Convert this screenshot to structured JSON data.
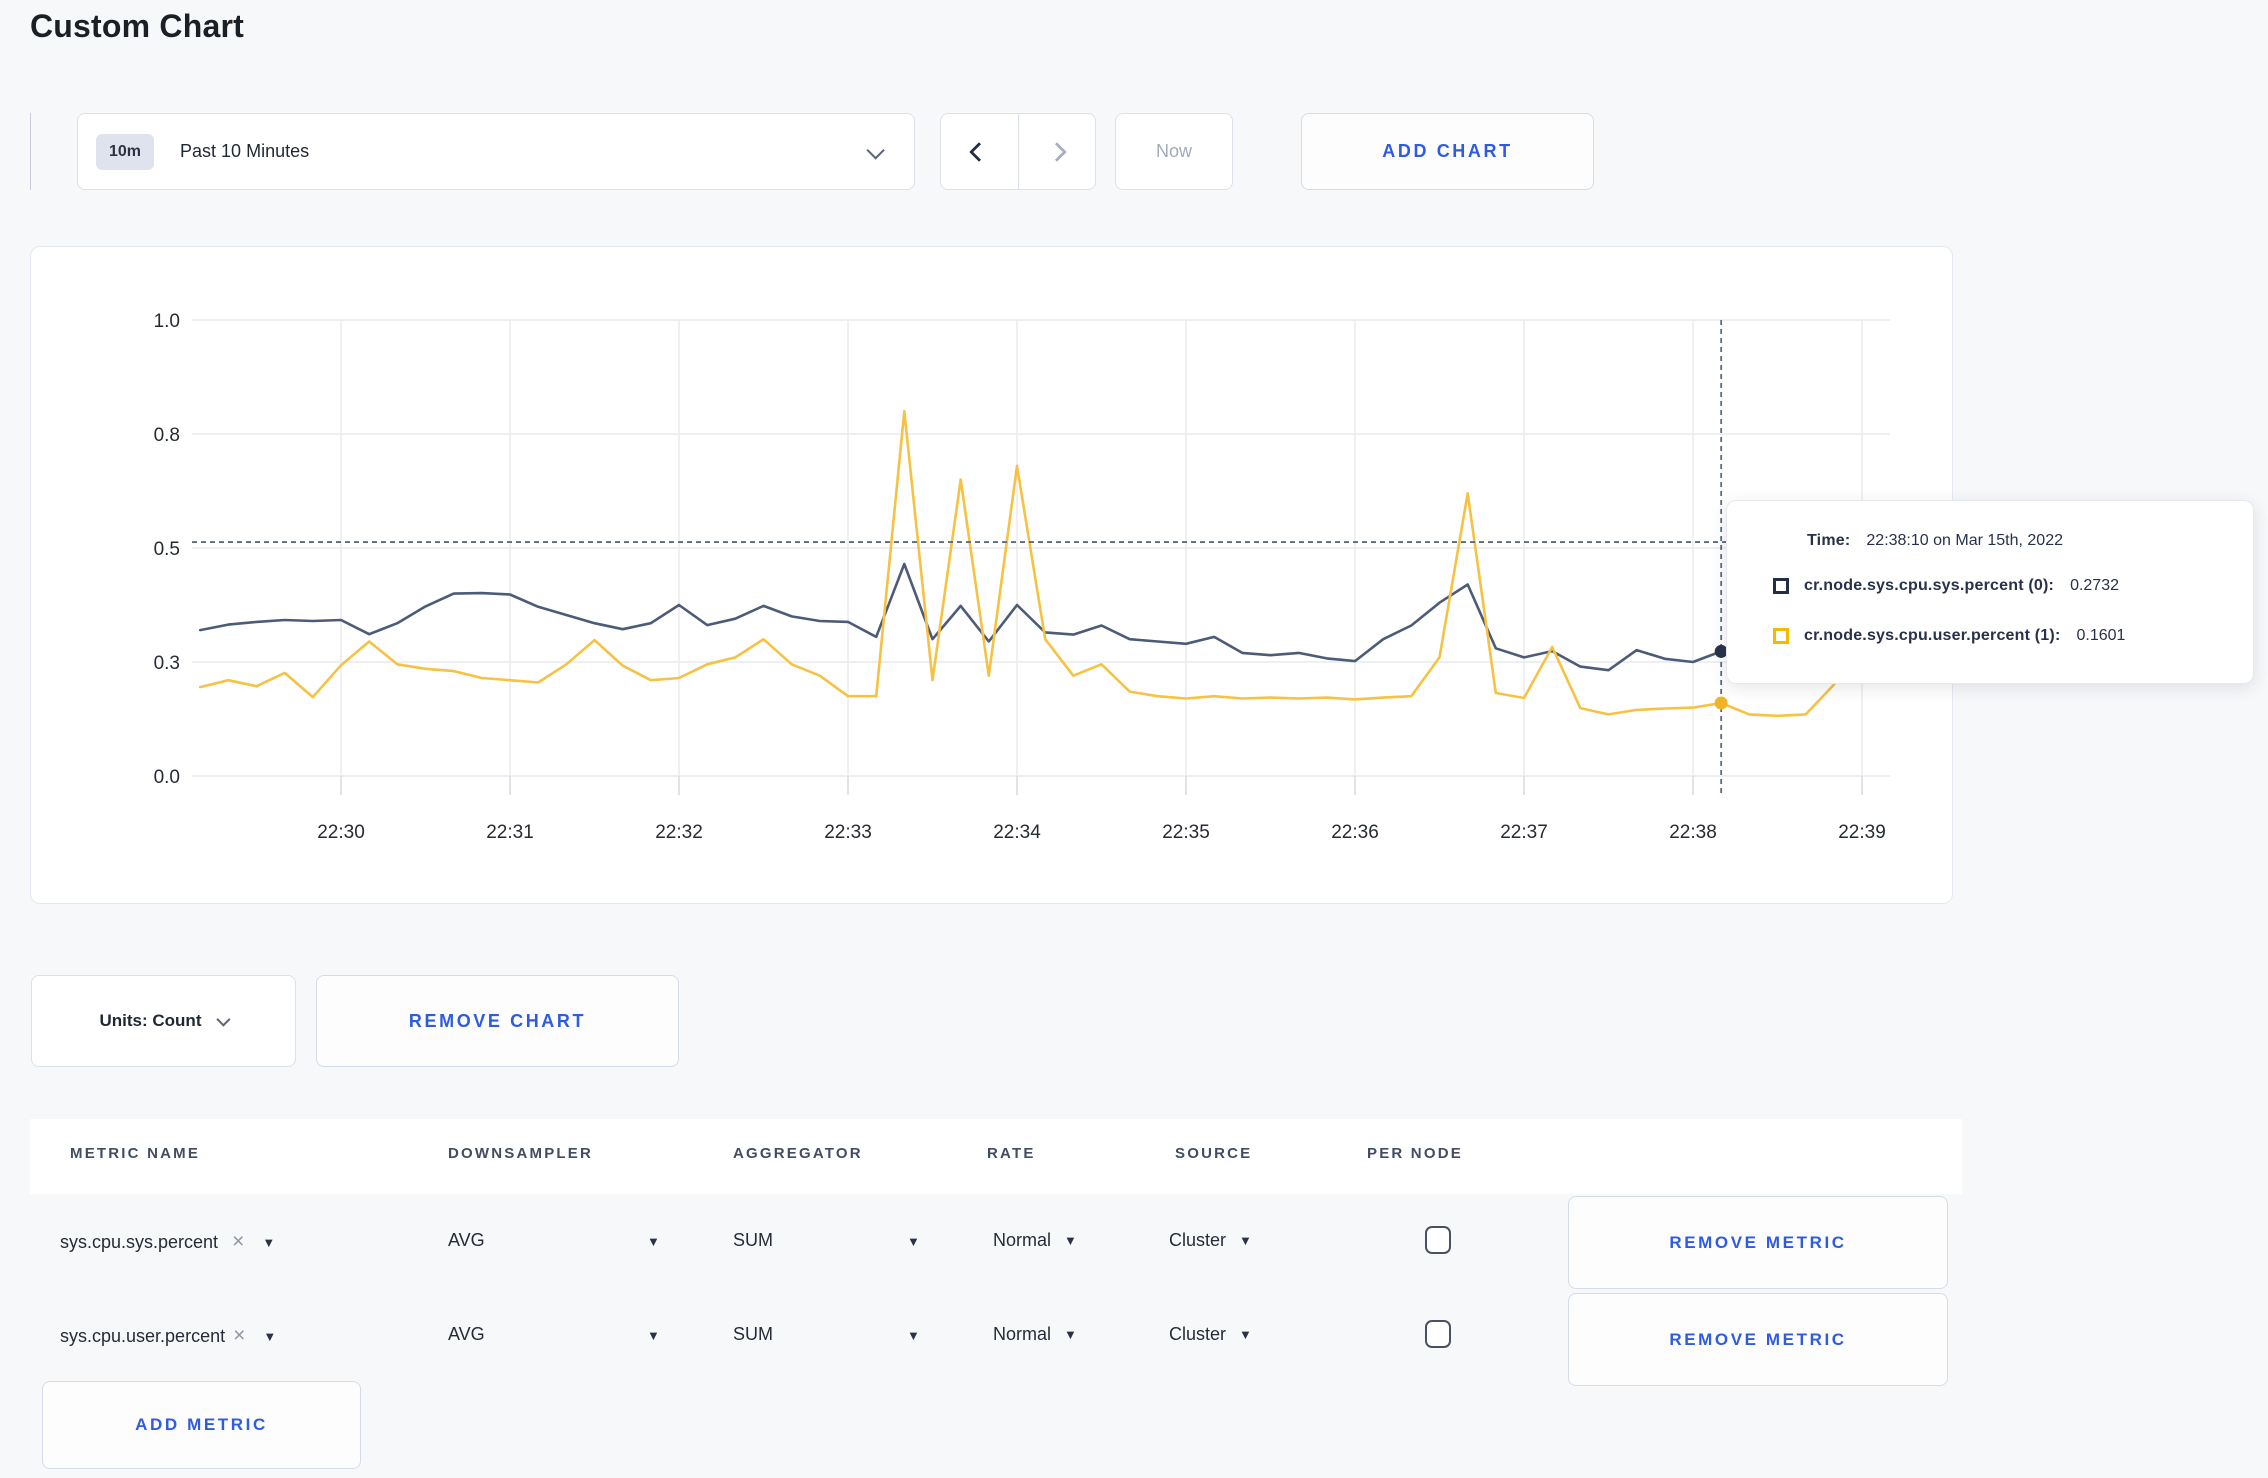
{
  "page": {
    "title": "Custom Chart"
  },
  "toolbar": {
    "range_badge": "10m",
    "range_label": "Past 10 Minutes",
    "now_label": "Now",
    "add_chart_label": "ADD CHART"
  },
  "chart_data": {
    "type": "line",
    "title": "",
    "x_start": "22:29:10",
    "x_step_seconds": 10,
    "x_tick_labels": [
      "22:30",
      "22:31",
      "22:32",
      "22:33",
      "22:34",
      "22:35",
      "22:36",
      "22:37",
      "22:38",
      "22:39"
    ],
    "y_ticks": [
      {
        "label": "0.0",
        "value": 0
      },
      {
        "label": "0.3",
        "value": 0.25
      },
      {
        "label": "0.5",
        "value": 0.5
      },
      {
        "label": "0.8",
        "value": 0.75
      },
      {
        "label": "1.0",
        "value": 1
      }
    ],
    "ylim": [
      0,
      1
    ],
    "grid": true,
    "series": [
      {
        "name": "cr.node.sys.cpu.sys.percent (0)",
        "color": "#4c5b77",
        "marker_color": "#273349",
        "values": [
          0.32,
          0.332,
          0.338,
          0.342,
          0.34,
          0.342,
          0.311,
          0.335,
          0.372,
          0.4,
          0.401,
          0.398,
          0.371,
          0.353,
          0.335,
          0.322,
          0.335,
          0.375,
          0.331,
          0.345,
          0.373,
          0.35,
          0.34,
          0.338,
          0.305,
          0.465,
          0.3,
          0.373,
          0.295,
          0.375,
          0.315,
          0.31,
          0.33,
          0.3,
          0.295,
          0.29,
          0.305,
          0.27,
          0.265,
          0.27,
          0.258,
          0.252,
          0.3,
          0.33,
          0.38,
          0.42,
          0.28,
          0.26,
          0.274,
          0.24,
          0.232,
          0.276,
          0.257,
          0.25,
          0.2732,
          0.262,
          0.27,
          0.29,
          0.3,
          0.295,
          0.3
        ]
      },
      {
        "name": "cr.node.sys.cpu.user.percent (1)",
        "color": "#f6c243",
        "marker_color": "#f0b429",
        "values": [
          0.195,
          0.21,
          0.197,
          0.226,
          0.173,
          0.243,
          0.295,
          0.245,
          0.235,
          0.23,
          0.215,
          0.21,
          0.205,
          0.245,
          0.298,
          0.242,
          0.21,
          0.215,
          0.245,
          0.26,
          0.3,
          0.245,
          0.22,
          0.175,
          0.175,
          0.8,
          0.21,
          0.65,
          0.22,
          0.68,
          0.3,
          0.22,
          0.245,
          0.185,
          0.175,
          0.17,
          0.175,
          0.17,
          0.172,
          0.17,
          0.172,
          0.168,
          0.172,
          0.175,
          0.26,
          0.62,
          0.182,
          0.171,
          0.283,
          0.149,
          0.135,
          0.145,
          0.148,
          0.15,
          0.1601,
          0.135,
          0.132,
          0.135,
          0.2,
          0.272,
          0.245
        ]
      }
    ],
    "crosshair": {
      "time": "22:38:10",
      "minutes_from_2230": 8.1667,
      "hover_value": 0.513,
      "point_values": [
        0.2732,
        0.1601
      ]
    },
    "legend_position": "tooltip"
  },
  "tooltip": {
    "time_label": "Time:",
    "time_value": "22:38:10 on Mar 15th, 2022",
    "rows": [
      {
        "label": "cr.node.sys.cpu.sys.percent (0):",
        "value": "0.2732",
        "color": "#232e45"
      },
      {
        "label": "cr.node.sys.cpu.user.percent (1):",
        "value": "0.1601",
        "color": "#f5b900"
      }
    ]
  },
  "units": {
    "label": "Units: Count"
  },
  "remove_chart_label": "REMOVE CHART",
  "table": {
    "headers": [
      "METRIC NAME",
      "DOWNSAMPLER",
      "AGGREGATOR",
      "RATE",
      "SOURCE",
      "PER NODE"
    ],
    "rows": [
      {
        "metric": "sys.cpu.sys.percent",
        "remove_x": "×",
        "downsampler": "AVG",
        "aggregator": "SUM",
        "rate": "Normal",
        "source": "Cluster",
        "per_node_checked": false,
        "remove_label": "REMOVE METRIC"
      },
      {
        "metric": "sys.cpu.user.percent",
        "remove_x": "×",
        "downsampler": "AVG",
        "aggregator": "SUM",
        "rate": "Normal",
        "source": "Cluster",
        "per_node_checked": false,
        "remove_label": "REMOVE METRIC"
      }
    ],
    "add_metric_label": "ADD METRIC"
  }
}
